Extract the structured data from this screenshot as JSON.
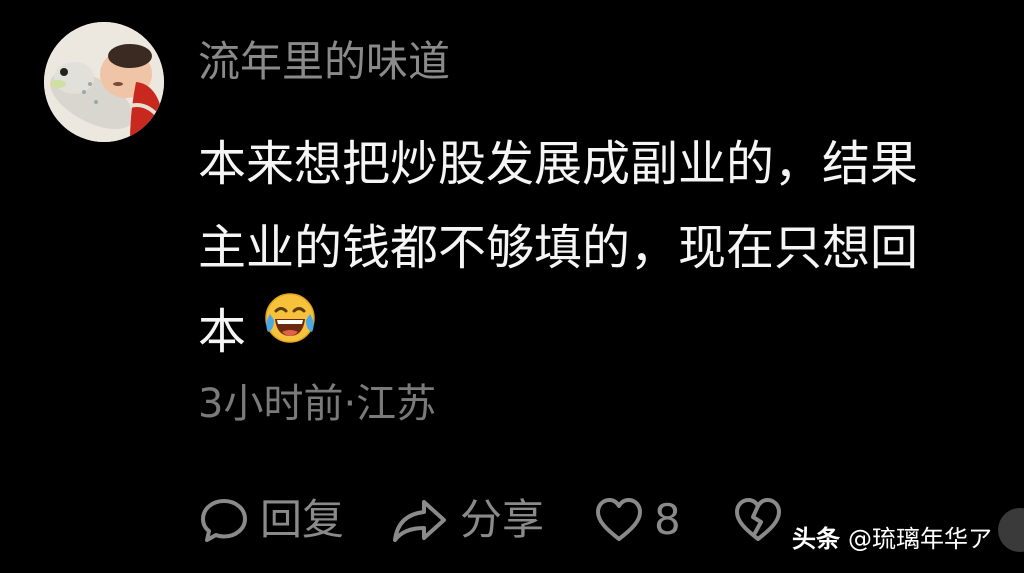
{
  "comment": {
    "username": "流年里的味道",
    "text_lines": [
      "本来想把炒股发展成副业的，结果",
      "主业的钱都不够填的，现在只想回",
      "本"
    ],
    "emoji": "laughing-crying-emoji",
    "meta": "3小时前·江苏"
  },
  "actions": {
    "reply_label": "回复",
    "share_label": "分享",
    "like_count": "8"
  },
  "watermark": {
    "brand": "头条",
    "handle": "@琉璃年华ア"
  },
  "icons": {
    "reply": "reply-bubble-icon",
    "share": "share-arrow-icon",
    "like": "heart-icon",
    "dislike": "broken-heart-icon"
  },
  "colors": {
    "background": "#000000",
    "text_primary": "#f5f5f5",
    "text_secondary": "#8a8a8a"
  }
}
